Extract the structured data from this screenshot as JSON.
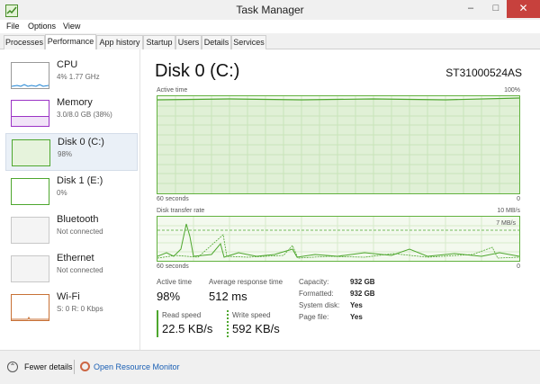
{
  "window": {
    "title": "Task Manager",
    "minimize_glyph": "–",
    "maximize_glyph": "□",
    "close_glyph": "✕"
  },
  "menu": [
    "File",
    "Options",
    "View"
  ],
  "tabs": [
    "Processes",
    "Performance",
    "App history",
    "Startup",
    "Users",
    "Details",
    "Services"
  ],
  "active_tab": "Performance",
  "sidebar": [
    {
      "name": "CPU",
      "detail": "4% 1.77 GHz",
      "color": "#1f84d4"
    },
    {
      "name": "Memory",
      "detail": "3.0/8.0 GB (38%)",
      "color": "#9b33c5"
    },
    {
      "name": "Disk 0 (C:)",
      "detail": "98%",
      "color": "#4ea72e",
      "selected": true
    },
    {
      "name": "Disk 1 (E:)",
      "detail": "0%",
      "color": "#4ea72e"
    },
    {
      "name": "Bluetooth",
      "detail": "Not connected",
      "color": "#aaaaaa"
    },
    {
      "name": "Ethernet",
      "detail": "Not connected",
      "color": "#aaaaaa"
    },
    {
      "name": "Wi-Fi",
      "detail": "S: 0 R: 0 Kbps",
      "color": "#c87136"
    }
  ],
  "main": {
    "title": "Disk 0 (C:)",
    "model": "ST31000524AS",
    "active_time_graph": {
      "label": "Active time",
      "max_label": "100%",
      "time_label": "60 seconds",
      "min_label": "0",
      "level_percent": 98
    },
    "transfer_graph": {
      "label": "Disk transfer rate",
      "max_label": "10 MB/s",
      "marker_label": "7 MB/s",
      "time_label": "60 seconds",
      "min_label": "0"
    },
    "stats": {
      "active_time_label": "Active time",
      "active_time_value": "98%",
      "response_label": "Average response time",
      "response_value": "512 ms",
      "read_label": "Read speed",
      "read_value": "22.5 KB/s",
      "write_label": "Write speed",
      "write_value": "592 KB/s"
    },
    "properties": [
      {
        "key": "Capacity:",
        "value": "932 GB"
      },
      {
        "key": "Formatted:",
        "value": "932 GB"
      },
      {
        "key": "System disk:",
        "value": "Yes"
      },
      {
        "key": "Page file:",
        "value": "Yes"
      }
    ]
  },
  "footer": {
    "fewer_details": "Fewer details",
    "resource_monitor": "Open Resource Monitor"
  },
  "colors": {
    "disk_green": "#4ea72e",
    "graph_fill": "#f3f9ee",
    "link_blue": "#1a5fb4"
  }
}
